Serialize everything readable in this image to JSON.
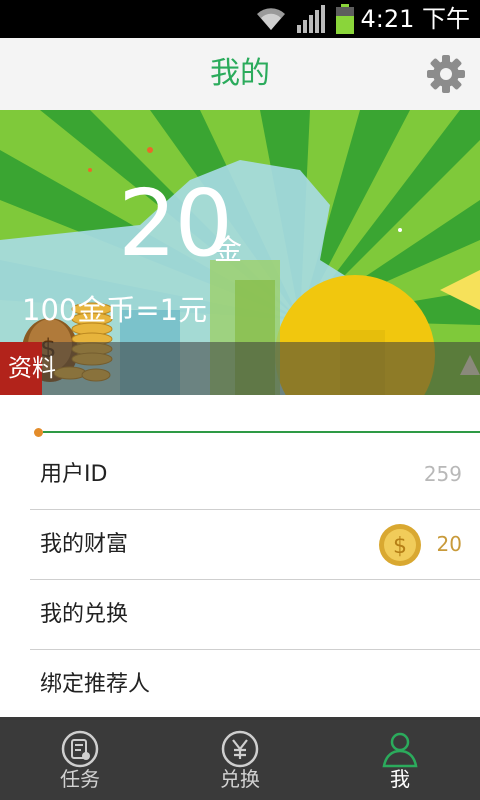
{
  "status_bar": {
    "time": "4:21 下午"
  },
  "header": {
    "title": "我的",
    "settings_icon": "gear-icon"
  },
  "banner": {
    "amount": "20",
    "unit": "金",
    "rate_text": "100金币=1元",
    "profile_label": "资料"
  },
  "list": {
    "items": [
      {
        "label": "用户ID",
        "value": "259"
      },
      {
        "label": "我的财富",
        "value": "20",
        "icon": "gold-coin-icon"
      },
      {
        "label": "我的兑换",
        "value": ""
      },
      {
        "label": "绑定推荐人",
        "value": ""
      }
    ]
  },
  "bottom_nav": {
    "items": [
      {
        "label": "任务",
        "icon": "task-icon"
      },
      {
        "label": "兑换",
        "icon": "yuan-exchange-icon"
      },
      {
        "label": "我",
        "icon": "user-icon",
        "active": true
      }
    ]
  },
  "colors": {
    "accent": "#2bab5c",
    "gold": "#c89a3a",
    "nav_bg": "#3a3a3a"
  }
}
